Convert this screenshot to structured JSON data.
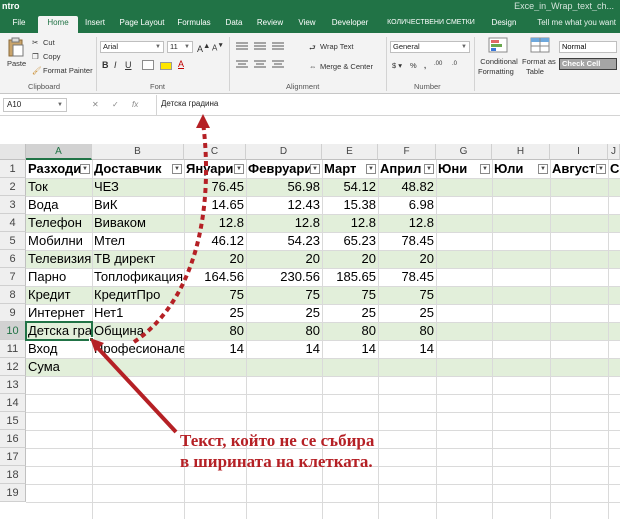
{
  "app": {
    "title_fragment": "ntro",
    "file_name": "Exce_in_Wrap_text_ch..."
  },
  "ribbon_tabs": [
    "File",
    "Home",
    "Insert",
    "Page Layout",
    "Formulas",
    "Data",
    "Review",
    "View",
    "Developer",
    "КОЛИЧЕСТВЕНИ СМЕТКИ",
    "Design"
  ],
  "active_tab": "Home",
  "tell_me": "Tell me what you want",
  "clipboard": {
    "paste": "Paste",
    "cut": "Cut",
    "copy": "Copy",
    "format_painter": "Format Painter",
    "label": "Clipboard"
  },
  "font": {
    "name": "Arial",
    "size": "11",
    "label": "Font"
  },
  "alignment": {
    "wrap_text": "Wrap Text",
    "merge_center": "Merge & Center",
    "label": "Alignment"
  },
  "number": {
    "format": "General",
    "label": "Number"
  },
  "styles": {
    "conditional": [
      "Conditional",
      "Formatting"
    ],
    "format_table": [
      "Format as",
      "Table"
    ],
    "normal": "Normal",
    "check_cell": "Check Cell"
  },
  "formula_bar": {
    "name_box": "A10",
    "value": "Детска градина"
  },
  "columns": [
    "A",
    "B",
    "C",
    "D",
    "E",
    "F",
    "G",
    "H",
    "I",
    "J"
  ],
  "rows": [
    "1",
    "2",
    "3",
    "4",
    "5",
    "6",
    "7",
    "8",
    "9",
    "10",
    "11",
    "12",
    "13",
    "14",
    "15",
    "16",
    "17",
    "18",
    "19"
  ],
  "table": {
    "headers": [
      "Разходи",
      "Доставчик",
      "Януари",
      "Февруари",
      "Март",
      "Април",
      "Юни",
      "Юли",
      "Август",
      "Се"
    ],
    "rows": [
      [
        "Ток",
        "ЧЕЗ",
        "76.45",
        "56.98",
        "54.12",
        "48.82"
      ],
      [
        "Вода",
        "ВиК",
        "14.65",
        "12.43",
        "15.38",
        "6.98"
      ],
      [
        "Телефон",
        "Виваком",
        "12.8",
        "12.8",
        "12.8",
        "12.8"
      ],
      [
        "Мобилни",
        "Мтел",
        "46.12",
        "54.23",
        "65.23",
        "78.45"
      ],
      [
        "Телевизия",
        "ТВ директ",
        "20",
        "20",
        "20",
        "20"
      ],
      [
        "Парно",
        "Топлофикация",
        "164.56",
        "230.56",
        "185.65",
        "78.45"
      ],
      [
        "Кредит",
        "КредитПро",
        "75",
        "75",
        "75",
        "75"
      ],
      [
        "Интернет",
        "Нет1",
        "25",
        "25",
        "25",
        "25"
      ],
      [
        "Детска гра",
        "Община",
        "80",
        "80",
        "80",
        "80"
      ],
      [
        "Вход",
        "Професионале",
        "14",
        "14",
        "14",
        "14"
      ],
      [
        "Сума",
        "",
        "",
        "",
        "",
        ""
      ]
    ]
  },
  "annotation": [
    "Текст, който не се събира",
    "в ширината на клетката."
  ],
  "colors": {
    "excel_green": "#217346",
    "band_green": "#e2efda",
    "annotation_red": "#b52025"
  }
}
